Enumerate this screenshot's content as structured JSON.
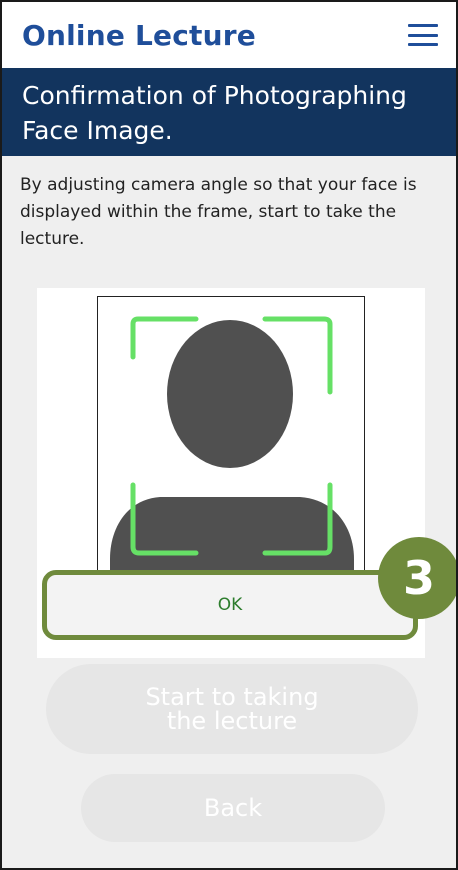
{
  "header": {
    "app_title": "Online Lecture",
    "menu_icon": "hamburger-menu-icon"
  },
  "page": {
    "title": "Confirmation of Photographing Face Image.",
    "instructions": "By adjusting camera angle so that your face is displayed within the frame, start to take the lecture."
  },
  "preview": {
    "placeholder_icon": "person-silhouette-icon",
    "guide_color": "#66e066"
  },
  "actions": {
    "ok_label": "OK",
    "start_label": "Start to taking the lecture",
    "back_label": "Back"
  },
  "annotation": {
    "step_number": "3",
    "color": "#6f8a3c"
  },
  "colors": {
    "brand_blue": "#1f4e9a",
    "title_bar": "#12345e",
    "disabled_button": "#e6e6e6"
  }
}
